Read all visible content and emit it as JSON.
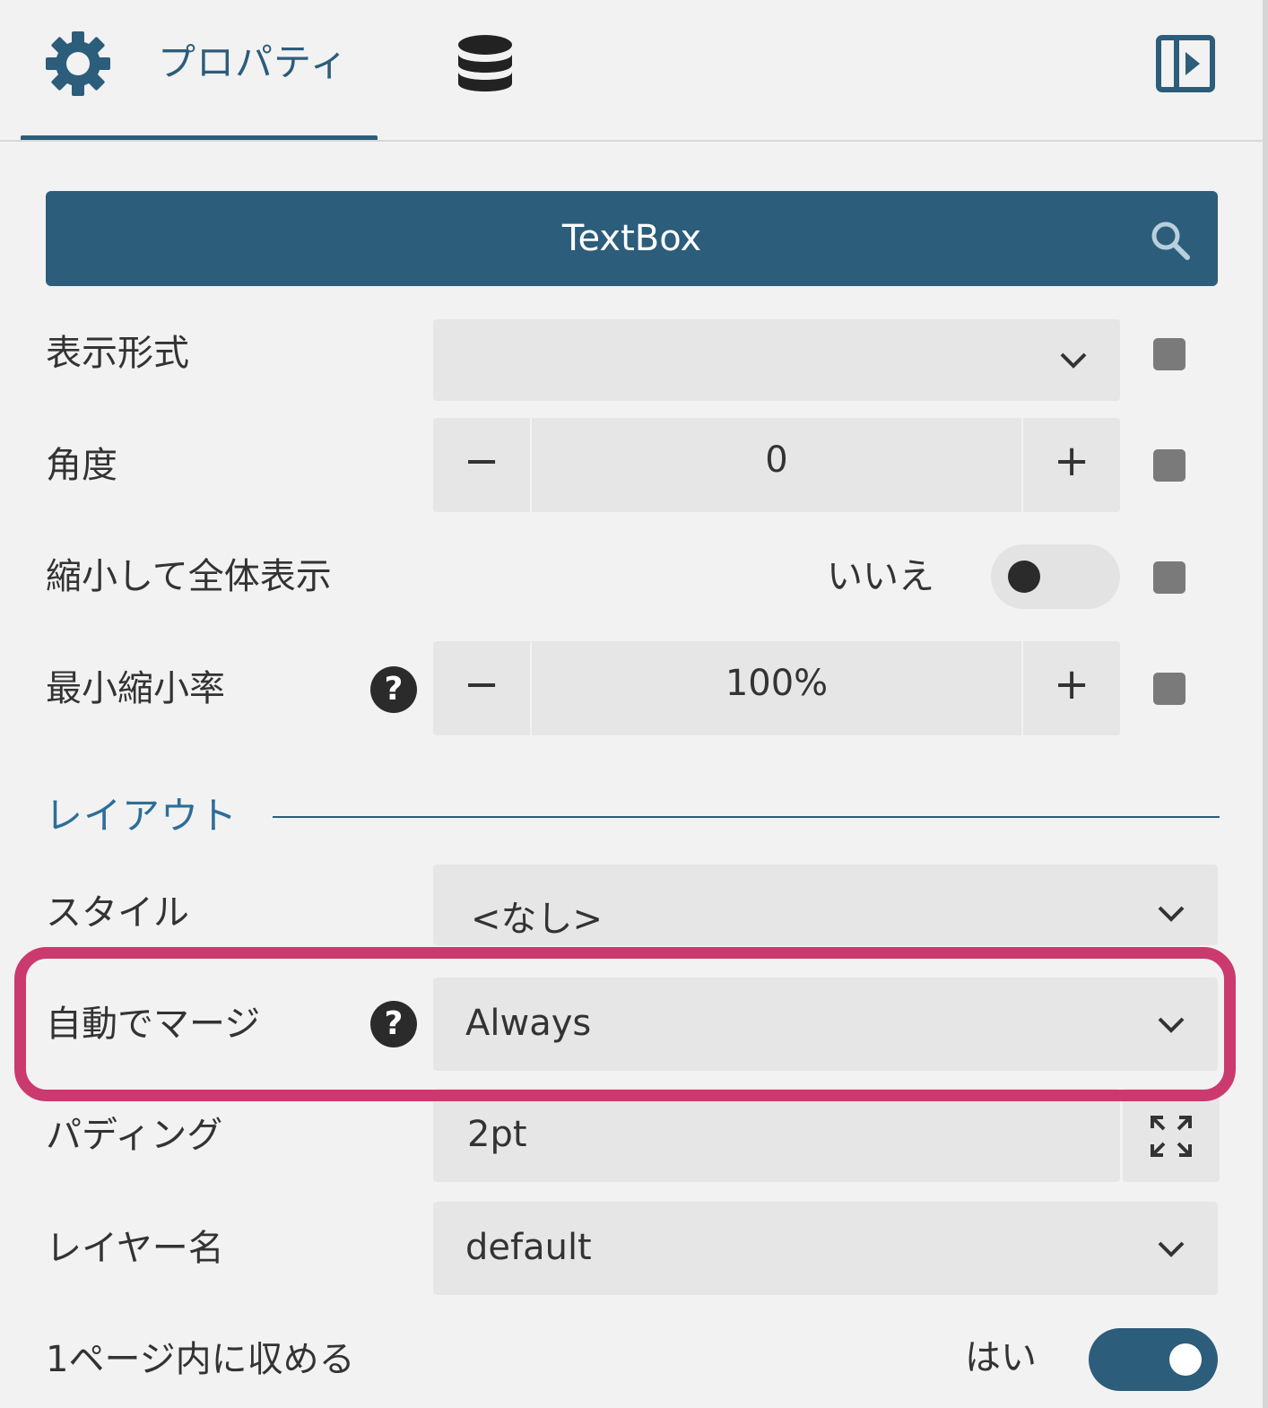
{
  "header": {
    "tab_properties_label": "プロパティ",
    "tab_properties_icon": "gear-icon",
    "tab_data_icon": "database-icon",
    "collapse_icon": "panel-collapse-icon",
    "accent_color": "#2c5d7a"
  },
  "object_selector": {
    "name": "TextBox",
    "icon": "search-icon"
  },
  "properties": {
    "format": {
      "label": "表示形式",
      "value": ""
    },
    "angle": {
      "label": "角度",
      "value": "0",
      "minus": "−",
      "plus": "+"
    },
    "shrink_to_fit": {
      "label": "縮小して全体表示",
      "value": "いいえ",
      "on": false
    },
    "min_shrink": {
      "label": "最小縮小率",
      "value": "100%",
      "minus": "−",
      "plus": "+",
      "help": "?"
    }
  },
  "layout_section": {
    "title": "レイアウト",
    "style": {
      "label": "スタイル",
      "value": "<なし>"
    },
    "auto_merge": {
      "label": "自動でマージ",
      "value": "Always",
      "help": "?"
    },
    "padding": {
      "label": "パディング",
      "value": "2pt",
      "icon": "expand-icon"
    },
    "layer_name": {
      "label": "レイヤー名",
      "value": "default"
    },
    "fit_one_page": {
      "label": "1ページ内に収める",
      "value": "はい",
      "on": true
    }
  },
  "highlight_color": "#cb3a6e"
}
